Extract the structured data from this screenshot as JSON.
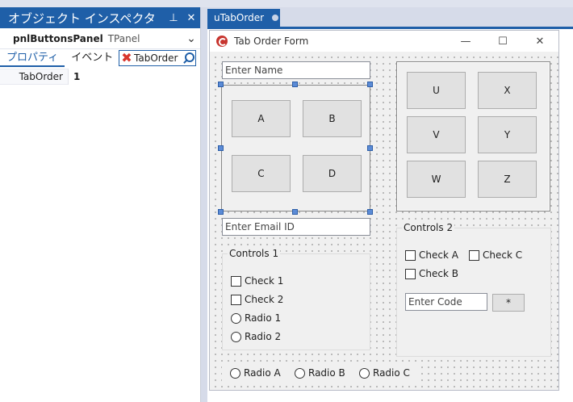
{
  "inspector": {
    "title": "オブジェクト インスペクタ",
    "pin_icon": "pin-icon",
    "close_icon": "close-icon",
    "object_name": "pnlButtonsPanel",
    "object_type": "TPanel",
    "tab_properties": "プロパティ",
    "tab_events": "イベント",
    "search_value": "TabOrder",
    "property_name": "TabOrder",
    "property_value": "1"
  },
  "document": {
    "tab_label": "uTabOrder"
  },
  "form": {
    "caption": "Tab Order Form",
    "minimize": "—",
    "maximize": "☐",
    "close": "✕",
    "name_placeholder": "Enter Name",
    "email_placeholder": "Enter Email ID",
    "code_placeholder": "Enter Code",
    "code_button": "*",
    "buttons_left": [
      "A",
      "B",
      "C",
      "D"
    ],
    "buttons_right": [
      "U",
      "X",
      "V",
      "Y",
      "W",
      "Z"
    ],
    "controls1": {
      "caption": "Controls 1",
      "check1": "Check 1",
      "check2": "Check 2",
      "radio1": "Radio 1",
      "radio2": "Radio 2"
    },
    "controls2": {
      "caption": "Controls 2",
      "checkA": "Check A",
      "checkC": "Check C",
      "checkB": "Check B"
    },
    "radios": [
      "Radio A",
      "Radio B",
      "Radio C"
    ]
  }
}
